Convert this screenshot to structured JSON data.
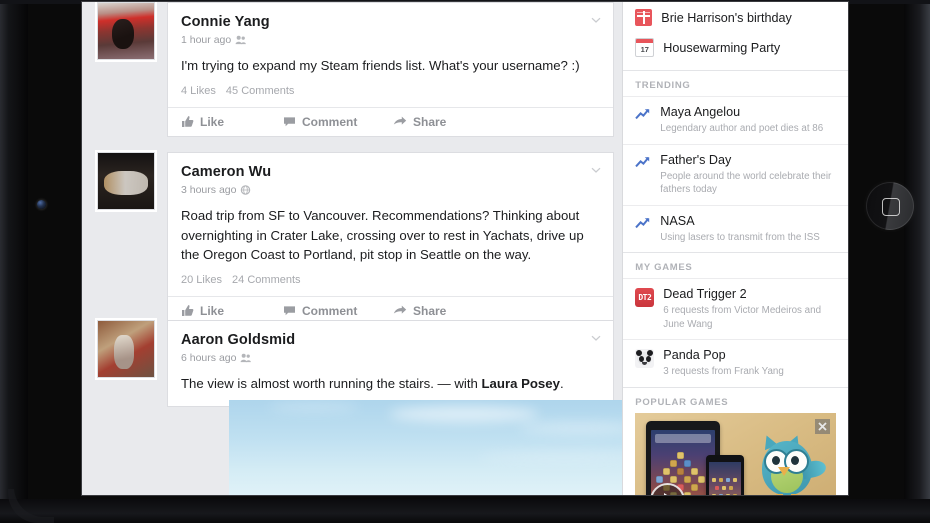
{
  "device": {
    "camera_icon": "camera-dot",
    "home_button_icon": "home-button"
  },
  "feed": {
    "posts": [
      {
        "author": "Connie Yang",
        "time": "1 hour ago",
        "audience_icon": "friends-icon",
        "message": "I'm trying to expand my Steam friends list. What's your username? :)",
        "likes": "4 Likes",
        "comments": "45 Comments",
        "actions": [
          {
            "label": "Like",
            "icon": "thumbs-up-icon"
          },
          {
            "label": "Comment",
            "icon": "comment-bubble-icon"
          },
          {
            "label": "Share",
            "icon": "share-arrow-icon"
          }
        ],
        "menu_icon": "chevron-down-icon",
        "avatar": "connie-yang-avatar"
      },
      {
        "author": "Cameron Wu",
        "time": "3 hours ago",
        "audience_icon": "public-globe-icon",
        "message": "Road trip from SF to Vancouver. Recommendations? Thinking about overnighting in Crater Lake, crossing over to rest in Yachats, drive up the Oregon Coast to Portland, pit stop in Seattle on the way.",
        "likes": "20 Likes",
        "comments": "24 Comments",
        "actions": [
          {
            "label": "Like",
            "icon": "thumbs-up-icon"
          },
          {
            "label": "Comment",
            "icon": "comment-bubble-icon"
          },
          {
            "label": "Share",
            "icon": "share-arrow-icon"
          }
        ],
        "menu_icon": "chevron-down-icon",
        "avatar": "cameron-wu-avatar"
      },
      {
        "author": "Aaron Goldsmid",
        "time": "6 hours ago",
        "audience_icon": "friends-icon",
        "message_prefix": "The view is almost worth running the stairs. — with ",
        "tagged_person": "Laura Posey",
        "message_suffix": ".",
        "menu_icon": "chevron-down-icon",
        "avatar": "aaron-goldsmid-avatar",
        "photo": "sky-photo"
      }
    ]
  },
  "rail": {
    "events": [
      {
        "title": "Brie Harrison's birthday",
        "icon": "gift-icon"
      },
      {
        "title": "Housewarming Party",
        "icon": "calendar-icon",
        "calendar_day": "17"
      }
    ],
    "trending": {
      "heading": "TRENDING",
      "items": [
        {
          "title": "Maya Angelou",
          "subtitle": "Legendary author and poet dies at 86",
          "icon": "trending-arrow-icon"
        },
        {
          "title": "Father's Day",
          "subtitle": "People around the world celebrate their fathers today",
          "icon": "trending-arrow-icon"
        },
        {
          "title": "NASA",
          "subtitle": "Using lasers to transmit from the ISS",
          "icon": "trending-arrow-icon"
        }
      ]
    },
    "my_games": {
      "heading": "MY GAMES",
      "items": [
        {
          "name": "Dead Trigger 2",
          "subtitle": "6 requests from Victor Medeiros and June Wang",
          "icon": "dead-trigger-2-icon",
          "icon_text": "DT2"
        },
        {
          "name": "Panda Pop",
          "subtitle": "3 requests from Frank Yang",
          "icon": "panda-pop-icon"
        }
      ]
    },
    "popular_games": {
      "heading": "POPULAR GAMES",
      "banner": {
        "close_icon": "close-icon",
        "play_icon": "play-button-icon",
        "artwork": "bubble-puzzle-game-promo"
      }
    }
  },
  "colors": {
    "accent_blue": "#3b5998",
    "trending_arrow": "#4c74c9",
    "event_red": "#e8555b",
    "page_bg": "#e9eaed",
    "card_bg": "#ffffff",
    "muted_text": "#a9abb0"
  }
}
